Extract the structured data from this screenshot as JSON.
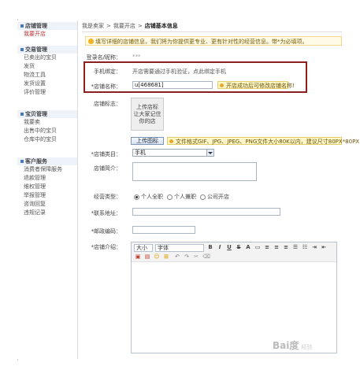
{
  "sidebar": {
    "groups": [
      {
        "head": "店铺管理",
        "items": [
          "我要开店"
        ]
      },
      {
        "head": "交易管理",
        "items": [
          "已卖出的宝贝",
          "发货",
          "物流工具",
          "发货设置",
          "评价管理"
        ]
      },
      {
        "head": "宝贝管理",
        "items": [
          "我要卖",
          "出售中的宝贝",
          "仓库中的宝贝"
        ]
      },
      {
        "head": "客户服务",
        "items": [
          "消费者保障服务",
          "退款管理",
          "维权管理",
          "举报管理",
          "咨询回复",
          "违规记录"
        ]
      }
    ]
  },
  "breadcrumb": {
    "a": "我是卖家",
    "sep1": ">",
    "b": "我要开店",
    "sep2": ">",
    "c": "店铺基本信息"
  },
  "notice": "填写详细的店铺信息，我们将为你提供更专业、更有针对性的经营信息。带*为必填项。",
  "form": {
    "login_label": "登录名/昵称：",
    "login_value": "***",
    "phone_label": "手机绑定：",
    "phone_value": "开店需要通过手机验证，点此绑定手机",
    "shop_name_label": "*店铺名称：",
    "shop_name_value": "u[468681]",
    "shop_name_hint": "开店成功后可修改店铺名称!",
    "logo_label": "店铺标志：",
    "logo_line1": "上传店标",
    "logo_line2": "让大家记住",
    "logo_line3": "你的店",
    "upload_button": "上传图标",
    "upload_hint": "文件格式GIF、JPG、JPEG、PNG文件大小80K以内，建议尺寸80PX*80PX",
    "category_label": "*店铺类目：",
    "category_value": "手机",
    "intro_label": "店铺简介：",
    "type_label": "经营类型：",
    "type_options": [
      "个人全职",
      "个人兼职",
      "公司开店"
    ],
    "address_label": "*联系地址：",
    "zip_label": "*邮政编码：",
    "desc_label": "*店铺介绍：",
    "editor_size": "大小",
    "editor_font": "字体"
  },
  "watermark": {
    "brand": "Bai度",
    "sub": "经验"
  }
}
